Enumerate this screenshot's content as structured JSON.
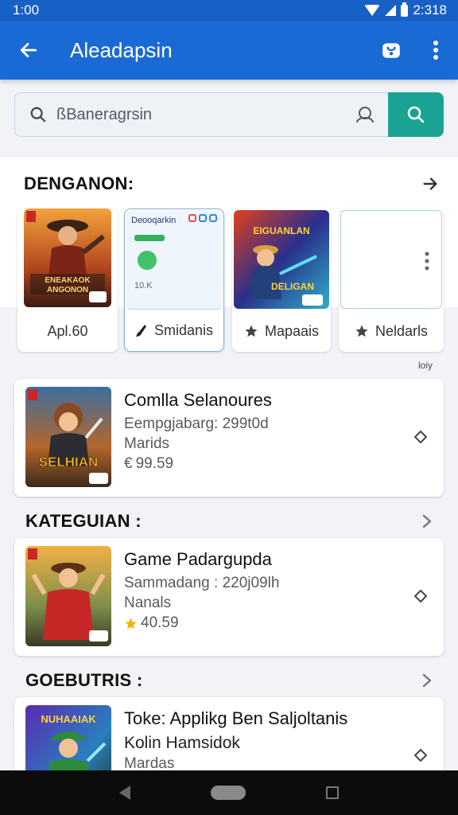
{
  "status": {
    "time": "1:00",
    "right": "2:318"
  },
  "app_bar": {
    "title": "Aleadapsin"
  },
  "search": {
    "value": "ßBaneragrsin"
  },
  "featured": {
    "title": "DENGANON:",
    "cards": [
      {
        "label": "Apl.60",
        "art_title": "ENEAKAOK\nANGONON",
        "has_icon": false,
        "icon": "none"
      },
      {
        "label": "Smidanis",
        "widget_title": "Deooqarkin",
        "widget_value": "10.K",
        "has_icon": true,
        "icon": "brush-icon"
      },
      {
        "label": "Mapaais",
        "art_title": "EIGUANLAN\nDELIGAN",
        "has_icon": true,
        "icon": "star-icon"
      },
      {
        "label": "Neldarls",
        "has_icon": true,
        "icon": "star-icon"
      }
    ],
    "note": "loiy"
  },
  "list": [
    {
      "title": "Comlla Selanoures",
      "line1": "Eempgjabarg: 299t0d",
      "line2": "Marids",
      "price": "99.59",
      "price_icon": "euro-icon"
    },
    {
      "title": "Game Padargupda",
      "line1": "Sammadang : 220j09lh",
      "line2": "Nanals",
      "price": "40.59",
      "price_icon": "star-icon"
    },
    {
      "title": "Toke: Applikg Ben Saljoltanis",
      "line1": "Kolin Hamsidok",
      "line2": "Mardas",
      "price": "",
      "price_icon": "none"
    }
  ],
  "sections": [
    {
      "title": "KATEGUIAN :"
    },
    {
      "title": "GOEBUTRIS :"
    }
  ],
  "colors": {
    "app_bar": "#1a6ad6",
    "search_button": "#1aa392",
    "star": "#f5b301"
  }
}
